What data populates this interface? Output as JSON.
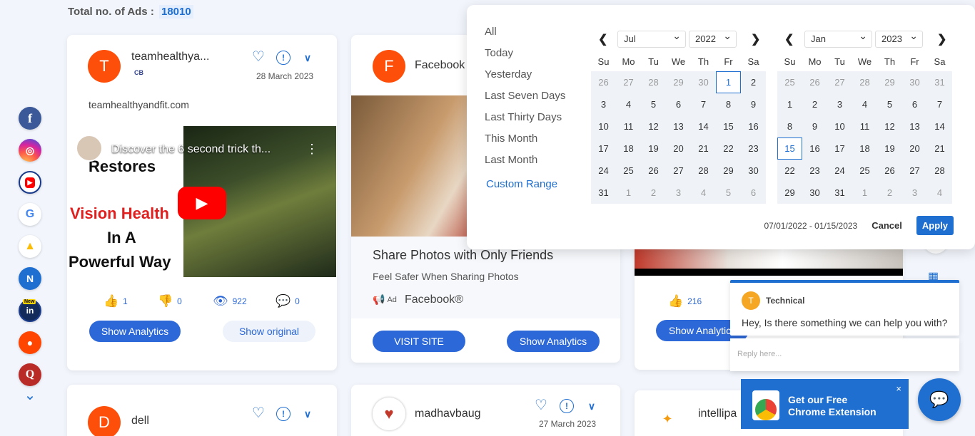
{
  "header": {
    "total_label": "Total no. of Ads :",
    "total_count": "18010"
  },
  "sidebar": {
    "items": [
      {
        "icon": "facebook-icon",
        "glyph": "f"
      },
      {
        "icon": "instagram-icon",
        "glyph": "◎"
      },
      {
        "icon": "youtube-icon",
        "glyph": "▶"
      },
      {
        "icon": "google-icon",
        "glyph": "G"
      },
      {
        "icon": "google-ads-icon",
        "glyph": "▲"
      },
      {
        "icon": "native-icon",
        "glyph": "N"
      },
      {
        "icon": "linkedin-icon",
        "glyph": "in",
        "badge": "New"
      },
      {
        "icon": "reddit-icon",
        "glyph": "●"
      },
      {
        "icon": "quora-icon",
        "glyph": "Q"
      }
    ],
    "more_glyph": "⌄"
  },
  "cards": {
    "c1": {
      "avatar": "T",
      "name": "teamhealthya...",
      "network": "CB",
      "date": "28 March 2023",
      "domain": "teamhealthyandfit.com",
      "video_title": "Discover the 6 second trick th...",
      "overlay": {
        "line1": "Restores",
        "line2": "Vision Health",
        "line3": "In A",
        "line4": "Powerful Way"
      },
      "likes": "1",
      "dislikes": "0",
      "views": "922",
      "comments": "0",
      "analytics_label": "Show Analytics",
      "original_label": "Show original"
    },
    "c2": {
      "avatar": "F",
      "name": "Facebook",
      "headline": "Share Photos with Only Friends",
      "description": "Feel Safer When Sharing Photos",
      "ad_label": "Ad",
      "advertiser": "Facebook®",
      "visit_label": "VISIT SITE",
      "analytics_label": "Show Analytics"
    },
    "c3": {
      "likes": "216",
      "analytics_label": "Show Analytics"
    },
    "c4": {
      "avatar": "D",
      "name": "dell"
    },
    "c5": {
      "name": "madhavbaug",
      "date": "27 March 2023"
    },
    "c6": {
      "name": "intellipa"
    }
  },
  "calendar": {
    "ranges": [
      "All",
      "Today",
      "Yesterday",
      "Last Seven Days",
      "Last Thirty Days",
      "This Month",
      "Last Month"
    ],
    "custom_range": "Custom Range",
    "weekdays": [
      "Su",
      "Mo",
      "Tu",
      "We",
      "Th",
      "Fr",
      "Sa"
    ],
    "left": {
      "month": "Jul",
      "year": "2022",
      "days": [
        [
          "26",
          "off"
        ],
        [
          "27",
          "off"
        ],
        [
          "28",
          "off"
        ],
        [
          "29",
          "off"
        ],
        [
          "30",
          "off"
        ],
        [
          "1",
          "sel"
        ],
        [
          "2",
          ""
        ],
        [
          "3",
          ""
        ],
        [
          "4",
          ""
        ],
        [
          "5",
          ""
        ],
        [
          "6",
          ""
        ],
        [
          "7",
          ""
        ],
        [
          "8",
          ""
        ],
        [
          "9",
          ""
        ],
        [
          "10",
          ""
        ],
        [
          "11",
          ""
        ],
        [
          "12",
          ""
        ],
        [
          "13",
          ""
        ],
        [
          "14",
          ""
        ],
        [
          "15",
          ""
        ],
        [
          "16",
          ""
        ],
        [
          "17",
          ""
        ],
        [
          "18",
          ""
        ],
        [
          "19",
          ""
        ],
        [
          "20",
          ""
        ],
        [
          "21",
          ""
        ],
        [
          "22",
          ""
        ],
        [
          "23",
          ""
        ],
        [
          "24",
          ""
        ],
        [
          "25",
          ""
        ],
        [
          "26",
          ""
        ],
        [
          "27",
          ""
        ],
        [
          "28",
          ""
        ],
        [
          "29",
          ""
        ],
        [
          "30",
          ""
        ],
        [
          "31",
          ""
        ],
        [
          "1",
          "off"
        ],
        [
          "2",
          "off"
        ],
        [
          "3",
          "off"
        ],
        [
          "4",
          "off"
        ],
        [
          "5",
          "off"
        ],
        [
          "6",
          "off"
        ]
      ]
    },
    "right": {
      "month": "Jan",
      "year": "2023",
      "days": [
        [
          "25",
          "off"
        ],
        [
          "26",
          "off"
        ],
        [
          "27",
          "off"
        ],
        [
          "28",
          "off"
        ],
        [
          "29",
          "off"
        ],
        [
          "30",
          "off"
        ],
        [
          "31",
          "off"
        ],
        [
          "1",
          ""
        ],
        [
          "2",
          ""
        ],
        [
          "3",
          ""
        ],
        [
          "4",
          ""
        ],
        [
          "5",
          ""
        ],
        [
          "6",
          ""
        ],
        [
          "7",
          ""
        ],
        [
          "8",
          ""
        ],
        [
          "9",
          ""
        ],
        [
          "10",
          ""
        ],
        [
          "11",
          ""
        ],
        [
          "12",
          ""
        ],
        [
          "13",
          ""
        ],
        [
          "14",
          ""
        ],
        [
          "15",
          "sel"
        ],
        [
          "16",
          ""
        ],
        [
          "17",
          ""
        ],
        [
          "18",
          ""
        ],
        [
          "19",
          ""
        ],
        [
          "20",
          ""
        ],
        [
          "21",
          ""
        ],
        [
          "22",
          ""
        ],
        [
          "23",
          ""
        ],
        [
          "24",
          ""
        ],
        [
          "25",
          ""
        ],
        [
          "26",
          ""
        ],
        [
          "27",
          ""
        ],
        [
          "28",
          ""
        ],
        [
          "29",
          ""
        ],
        [
          "30",
          ""
        ],
        [
          "31",
          ""
        ],
        [
          "1",
          "off"
        ],
        [
          "2",
          "off"
        ],
        [
          "3",
          "off"
        ],
        [
          "4",
          "off"
        ]
      ]
    },
    "selected_range": "07/01/2022 - 01/15/2023",
    "cancel_label": "Cancel",
    "apply_label": "Apply"
  },
  "chat": {
    "agent_initial": "T",
    "agent_name": "Technical",
    "message": "Hey, Is there something we can help you with?",
    "reply_placeholder": "Reply here..."
  },
  "extension": {
    "line1": "Get our Free",
    "line2": "Chrome Extension",
    "close": "×"
  },
  "colors": {
    "accent": "#1f6fd1",
    "button": "#2d68d8",
    "avatar": "#fe4f0a"
  }
}
